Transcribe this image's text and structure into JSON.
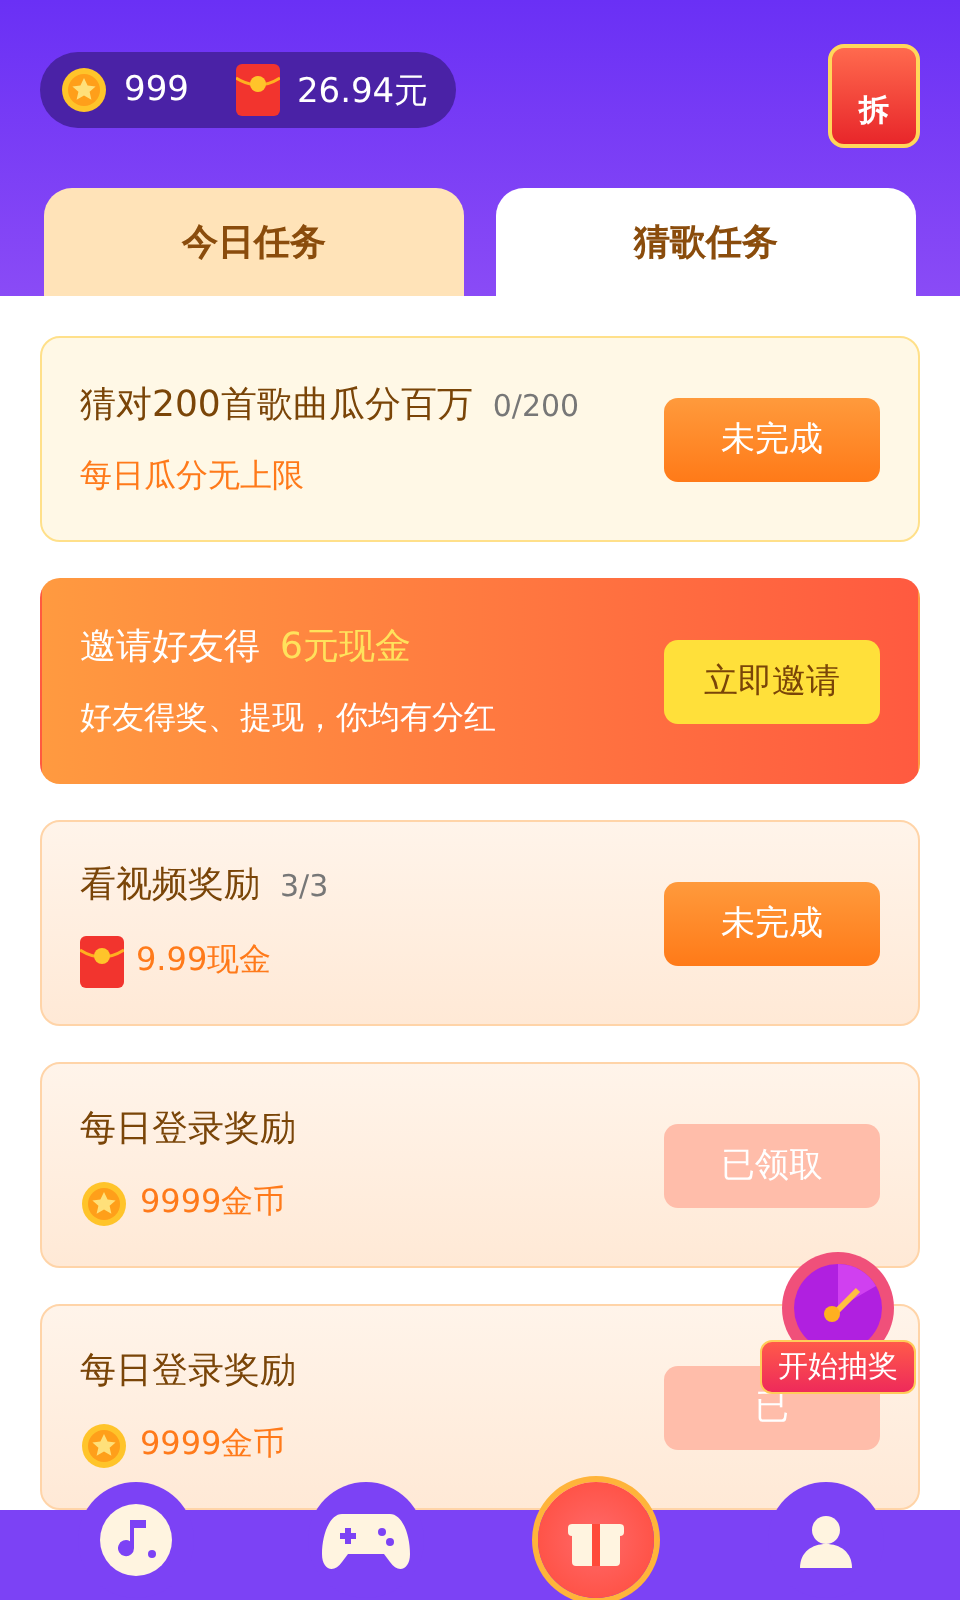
{
  "wallet": {
    "coins": "999",
    "cash": "26.94元"
  },
  "red_packet_button": {
    "label": "拆"
  },
  "tabs": [
    {
      "label": "今日任务",
      "selected": false
    },
    {
      "label": "猜歌任务",
      "selected": true
    }
  ],
  "tasks": [
    {
      "kind": "task",
      "title": "猜对200首歌曲瓜分百万",
      "progress": "0/200",
      "reward": {
        "kind": "text",
        "text": "每日瓜分无上限"
      },
      "button": "未完成",
      "claimed": false
    },
    {
      "kind": "invite",
      "title": "邀请好友得",
      "highlight": "6元现金",
      "subtitle": "好友得奖、提现，你均有分红",
      "button": "立即邀请"
    },
    {
      "kind": "task",
      "title": "看视频奖励",
      "progress": "3/3",
      "reward": {
        "kind": "cash",
        "text": "9.99现金"
      },
      "button": "未完成",
      "claimed": false
    },
    {
      "kind": "task",
      "title": "每日登录奖励",
      "reward": {
        "kind": "coin",
        "text": "9999金币"
      },
      "button": "已领取",
      "claimed": true
    },
    {
      "kind": "task",
      "title": "每日登录奖励",
      "reward": {
        "kind": "coin",
        "text": "9999金币"
      },
      "button": "已",
      "claimed": true
    }
  ],
  "lottery_badge": {
    "label": "开始抽奖"
  },
  "nav_items": [
    {
      "selected": false
    },
    {
      "selected": false
    },
    {
      "selected": true
    },
    {
      "selected": false
    }
  ]
}
